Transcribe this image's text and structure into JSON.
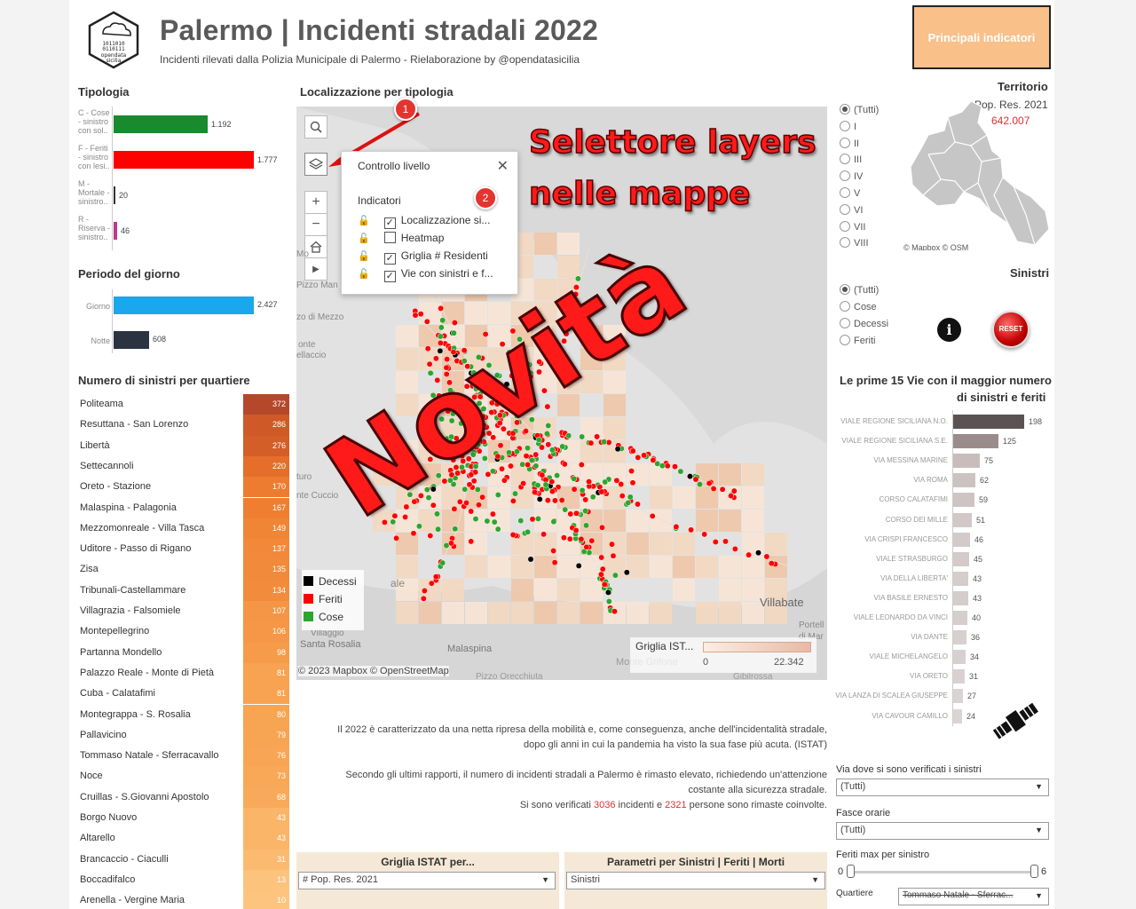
{
  "header": {
    "title": "Palermo | Incidenti stradali 2022",
    "subtitle": "Incidenti rilevati dalla Polizia Municipale di Palermo - Rielaborazione by @opendatasicilia",
    "logo_text_1": "opendata",
    "logo_text_2": "sicilia",
    "main_button": "Principali indicatori"
  },
  "tipologia": {
    "title": "Tipologia",
    "items": [
      {
        "label": "C - Cose - sinistro con sol..",
        "value": "1.192",
        "num": 1192,
        "color": "#1a8a2e"
      },
      {
        "label": "F - Feriti - sinistro con lesi..",
        "value": "1.777",
        "num": 1777,
        "color": "#ff0000"
      },
      {
        "label": "M - Mortale - sinistro..",
        "value": "20",
        "num": 20,
        "color": "#333333"
      },
      {
        "label": "R - Riserva - sinistro..",
        "value": "46",
        "num": 46,
        "color": "#c0398a"
      }
    ]
  },
  "periodo": {
    "title": "Periodo del giorno",
    "items": [
      {
        "label": "Giorno",
        "value": "2.427",
        "num": 2427,
        "color": "#1aa7ec"
      },
      {
        "label": "Notte",
        "value": "608",
        "num": 608,
        "color": "#2b3340"
      }
    ]
  },
  "quartieri": {
    "title": "Numero di sinistri per quartiere",
    "rows": [
      {
        "name": "Politeama",
        "value": "372",
        "color": "#b5482a"
      },
      {
        "name": "Resuttana - San Lorenzo",
        "value": "286",
        "color": "#cf5a27"
      },
      {
        "name": "Libertà",
        "value": "276",
        "color": "#d35e27"
      },
      {
        "name": "Settecannoli",
        "value": "220",
        "color": "#e46e2a"
      },
      {
        "name": "Oreto - Stazione",
        "value": "170",
        "color": "#ee7c30"
      },
      {
        "name": "Malaspina - Palagonia",
        "value": "167",
        "color": "#ef7e31"
      },
      {
        "name": "Mezzomonreale - Villa Tasca",
        "value": "149",
        "color": "#f18536"
      },
      {
        "name": "Uditore - Passo di Rigano",
        "value": "137",
        "color": "#f2893a"
      },
      {
        "name": "Zisa",
        "value": "135",
        "color": "#f28a3b"
      },
      {
        "name": "Tribunali-Castellammare",
        "value": "134",
        "color": "#f38b3c"
      },
      {
        "name": "Villagrazia - Falsomiele",
        "value": "107",
        "color": "#f59646"
      },
      {
        "name": "Montepellegrino",
        "value": "106",
        "color": "#f59746"
      },
      {
        "name": "Partanna Mondello",
        "value": "98",
        "color": "#f69b4a"
      },
      {
        "name": "Palazzo Reale - Monte di Pietà",
        "value": "81",
        "color": "#f7a352"
      },
      {
        "name": "Cuba - Calatafimi",
        "value": "81",
        "color": "#f7a352"
      },
      {
        "name": "Montegrappa - S. Rosalia",
        "value": "80",
        "color": "#f7a453"
      },
      {
        "name": "Pallavicino",
        "value": "79",
        "color": "#f7a553"
      },
      {
        "name": "Tommaso Natale - Sferracavallo",
        "value": "76",
        "color": "#f8a655"
      },
      {
        "name": "Noce",
        "value": "73",
        "color": "#f8a857"
      },
      {
        "name": "Cruillas - S.Giovanni Apostolo",
        "value": "68",
        "color": "#f8aa5a"
      },
      {
        "name": "Borgo Nuovo",
        "value": "43",
        "color": "#fab569"
      },
      {
        "name": "Altarello",
        "value": "43",
        "color": "#fab569"
      },
      {
        "name": "Brancaccio - Ciaculli",
        "value": "31",
        "color": "#fbba70"
      },
      {
        "name": "Boccadifalco",
        "value": "13",
        "color": "#fcc37c"
      },
      {
        "name": "Arenella - Vergine Maria",
        "value": "10",
        "color": "#fcc47e"
      }
    ]
  },
  "map": {
    "title": "Localizzazione per tipologia",
    "panel_title": "Controllo livello",
    "panel_section": "Indicatori",
    "layers": [
      {
        "label": "Localizzazione si...",
        "checked": "✓"
      },
      {
        "label": "Heatmap",
        "checked": ""
      },
      {
        "label": "Griglia # Residenti",
        "checked": "✓"
      },
      {
        "label": "Vie con sinistri e f...",
        "checked": "✓"
      }
    ],
    "place_labels": [
      "Pizzo Man",
      "zo di Mezzo",
      "onte",
      "ellaccio",
      "turo",
      "nte Cuccio",
      "Villabate",
      "Portell",
      "di Mar",
      "Villaggio",
      "Santa Rosalia",
      "Malaspina",
      "Monte Grifone",
      "Pizzo Orecchiuta",
      "Gibilrossa",
      "Mo",
      "ale"
    ],
    "legend": [
      {
        "label": "Decessi",
        "color": "#000000"
      },
      {
        "label": "Feriti",
        "color": "#ff0000"
      },
      {
        "label": "Cose",
        "color": "#2ea52e"
      }
    ],
    "grid_legend_title": "Griglia IST...",
    "grid_min": "0",
    "grid_max": "22.342",
    "attribution": "© 2023 Mapbox  © OpenStreetMap",
    "marker_1": "1",
    "marker_2": "2",
    "overlay_line1": "Selettore layers",
    "overlay_line2": "nelle mappe",
    "overlay_big": "Novità"
  },
  "territorio": {
    "title": "Territorio",
    "pop_label": "Pop. Res. 2021",
    "pop_value": "642.007",
    "attribution": "© Mapbox  © OSM",
    "options": [
      "(Tutti)",
      "I",
      "II",
      "III",
      "IV",
      "V",
      "VI",
      "VII",
      "VIII"
    ]
  },
  "sinistri": {
    "title": "Sinistri",
    "options": [
      "(Tutti)",
      "Cose",
      "Decessi",
      "Feriti"
    ],
    "reset_label": "RESET",
    "info_icon": "i"
  },
  "vie": {
    "title_line1": "Le prime 15 Vie con il maggior numero",
    "title_line2": "di sinistri e feriti",
    "items": [
      {
        "label": "VIALE REGIONE SICILIANA N.O.",
        "value": "198",
        "num": 198,
        "color": "#5b5253"
      },
      {
        "label": "VIALE REGIONE SICILIANA S.E.",
        "value": "125",
        "num": 125,
        "color": "#9b8c8c"
      },
      {
        "label": "VIA MESSINA MARINE",
        "value": "75",
        "num": 75,
        "color": "#c8bcbc"
      },
      {
        "label": "VIA ROMA",
        "value": "62",
        "num": 62,
        "color": "#cdc2c2"
      },
      {
        "label": "CORSO CALATAFIMI",
        "value": "59",
        "num": 59,
        "color": "#cfc4c4"
      },
      {
        "label": "CORSO DEI MILLE",
        "value": "51",
        "num": 51,
        "color": "#d2c8c8"
      },
      {
        "label": "VIA CRISPI FRANCESCO",
        "value": "46",
        "num": 46,
        "color": "#d4caca"
      },
      {
        "label": "VIALE STRASBURGO",
        "value": "45",
        "num": 45,
        "color": "#d4caca"
      },
      {
        "label": "VIA DELLA LIBERTA'",
        "value": "43",
        "num": 43,
        "color": "#d5cccc"
      },
      {
        "label": "VIA BASILE ERNESTO",
        "value": "43",
        "num": 43,
        "color": "#d5cccc"
      },
      {
        "label": "VIALE LEONARDO DA VINCI",
        "value": "40",
        "num": 40,
        "color": "#d6cdcd"
      },
      {
        "label": "VIA DANTE",
        "value": "36",
        "num": 36,
        "color": "#d8cfcf"
      },
      {
        "label": "VIALE MICHELANGELO",
        "value": "34",
        "num": 34,
        "color": "#d8d0d0"
      },
      {
        "label": "VIA ORETO",
        "value": "31",
        "num": 31,
        "color": "#d9d1d1"
      },
      {
        "label": "VIA LANZA DI SCALEA GIUSEPPE",
        "value": "27",
        "num": 27,
        "color": "#dad3d3"
      },
      {
        "label": "VIA CAVOUR CAMILLO",
        "value": "24",
        "num": 24,
        "color": "#dbd4d4"
      }
    ]
  },
  "info": {
    "p1_line1": "Il 2022 è caratterizzato da una netta ripresa della mobilità e, come conseguenza, anche dell'incidentalità stradale,",
    "p1_line2": "dopo gli anni in cui la pandemia ha visto la sua fase più acuta. (ISTAT)",
    "p2_line1": "Secondo gli ultimi rapporti, il numero di incidenti stradali a Palermo è rimasto elevato, richiedendo un'attenzione",
    "p2_line2": "costante alla sicurezza stradale.",
    "p3_pre": "Si sono verificati ",
    "p3_incidenti": "3036",
    "p3_mid": " incidenti e ",
    "p3_persone": "2321",
    "p3_post": " persone sono rimaste coinvolte."
  },
  "params": {
    "griglia_title": "Griglia ISTAT per...",
    "griglia_value": "# Pop. Res. 2021",
    "parametri_title": "Parametri per Sinistri | Feriti | Morti",
    "parametri_value": "Sinistri"
  },
  "filters": {
    "via_label": "Via dove si sono verificati i sinistri",
    "via_value": "(Tutti)",
    "fasce_label": "Fasce orarie",
    "fasce_value": "(Tutti)",
    "feriti_label": "Feriti max per sinistro",
    "feriti_min": "0",
    "feriti_max": "6",
    "quartiere_label": "Quartiere",
    "quartiere_value": "Tommaso Natale - Sferrac..."
  },
  "colors": {
    "accent_orange": "#f9c08a",
    "feriti_red": "#ff0000",
    "cose_green": "#2ea52e",
    "decessi_black": "#000000",
    "pop_red": "#e03030"
  }
}
